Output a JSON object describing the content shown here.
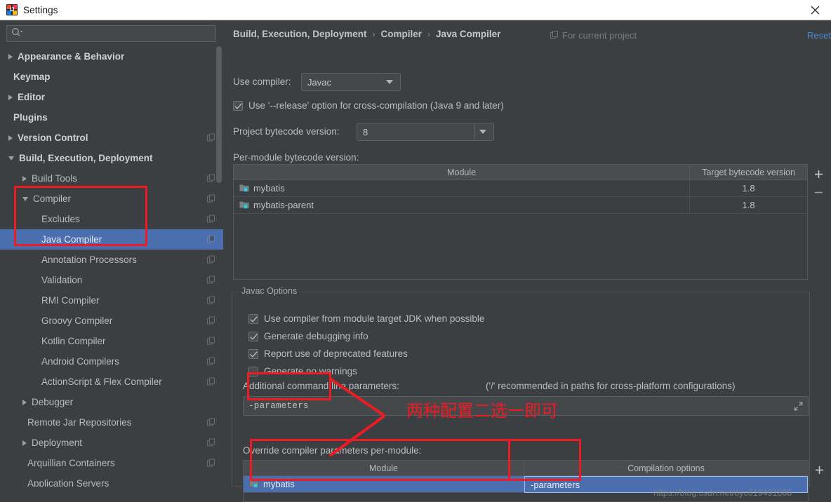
{
  "window": {
    "title": "Settings",
    "app_icon": "intellij-idea-icon",
    "close_icon": "close-icon"
  },
  "sidebar": {
    "search": {
      "placeholder": "",
      "value": "",
      "icon": "search-icon"
    },
    "items": [
      {
        "label": "Appearance & Behavior",
        "indent": 0,
        "arrow": "closed",
        "bold": true,
        "copy": false,
        "selected": false
      },
      {
        "label": "Keymap",
        "indent": 0,
        "arrow": "none",
        "bold": true,
        "copy": false,
        "selected": false
      },
      {
        "label": "Editor",
        "indent": 0,
        "arrow": "closed",
        "bold": true,
        "copy": false,
        "selected": false
      },
      {
        "label": "Plugins",
        "indent": 0,
        "arrow": "none",
        "bold": true,
        "copy": false,
        "selected": false
      },
      {
        "label": "Version Control",
        "indent": 0,
        "arrow": "closed",
        "bold": true,
        "copy": true,
        "selected": false
      },
      {
        "label": "Build, Execution, Deployment",
        "indent": 0,
        "arrow": "open",
        "bold": true,
        "copy": false,
        "selected": false
      },
      {
        "label": "Build Tools",
        "indent": 1,
        "arrow": "closed",
        "bold": false,
        "copy": true,
        "selected": false
      },
      {
        "label": "Compiler",
        "indent": 1,
        "arrow": "open",
        "bold": false,
        "copy": true,
        "selected": false
      },
      {
        "label": "Excludes",
        "indent": 2,
        "arrow": "none",
        "bold": false,
        "copy": true,
        "selected": false
      },
      {
        "label": "Java Compiler",
        "indent": 2,
        "arrow": "none",
        "bold": false,
        "copy": true,
        "selected": true
      },
      {
        "label": "Annotation Processors",
        "indent": 2,
        "arrow": "none",
        "bold": false,
        "copy": true,
        "selected": false
      },
      {
        "label": "Validation",
        "indent": 2,
        "arrow": "none",
        "bold": false,
        "copy": true,
        "selected": false
      },
      {
        "label": "RMI Compiler",
        "indent": 2,
        "arrow": "none",
        "bold": false,
        "copy": true,
        "selected": false
      },
      {
        "label": "Groovy Compiler",
        "indent": 2,
        "arrow": "none",
        "bold": false,
        "copy": true,
        "selected": false
      },
      {
        "label": "Kotlin Compiler",
        "indent": 2,
        "arrow": "none",
        "bold": false,
        "copy": true,
        "selected": false
      },
      {
        "label": "Android Compilers",
        "indent": 2,
        "arrow": "none",
        "bold": false,
        "copy": true,
        "selected": false
      },
      {
        "label": "ActionScript & Flex Compiler",
        "indent": 2,
        "arrow": "none",
        "bold": false,
        "copy": true,
        "selected": false
      },
      {
        "label": "Debugger",
        "indent": 1,
        "arrow": "closed",
        "bold": false,
        "copy": false,
        "selected": false
      },
      {
        "label": "Remote Jar Repositories",
        "indent": 1,
        "arrow": "none",
        "bold": false,
        "copy": true,
        "selected": false
      },
      {
        "label": "Deployment",
        "indent": 1,
        "arrow": "closed",
        "bold": false,
        "copy": true,
        "selected": false
      },
      {
        "label": "Arquillian Containers",
        "indent": 1,
        "arrow": "none",
        "bold": false,
        "copy": true,
        "selected": false
      },
      {
        "label": "Application Servers",
        "indent": 1,
        "arrow": "none",
        "bold": false,
        "copy": false,
        "selected": false
      }
    ]
  },
  "header": {
    "breadcrumb": [
      "Build, Execution, Deployment",
      "Compiler",
      "Java Compiler"
    ],
    "separator": "›",
    "scope_label": "For current project",
    "scope_icon": "copy-icon",
    "reset_label": "Reset",
    "reset_color": "#4e86d6"
  },
  "main": {
    "use_compiler_label": "Use compiler:",
    "use_compiler_value": "Javac",
    "release_option_label": "Use '--release' option for cross-compilation (Java 9 and later)",
    "release_option_checked": true,
    "project_bytecode_label": "Project bytecode version:",
    "project_bytecode_value": "8",
    "per_module_label": "Per-module bytecode version:",
    "bytecode_table": {
      "columns": [
        "Module",
        "Target bytecode version"
      ],
      "rows": [
        {
          "module": "mybatis",
          "version": "1.8"
        },
        {
          "module": "mybatis-parent",
          "version": "1.8"
        }
      ],
      "add_label": "+",
      "remove_label": "–"
    },
    "javac_group_title": "Javac Options",
    "javac_options": [
      {
        "label": "Use compiler from module target JDK when possible",
        "checked": true
      },
      {
        "label": "Generate debugging info",
        "checked": true
      },
      {
        "label": "Report use of deprecated features",
        "checked": true
      },
      {
        "label": "Generate no warnings",
        "checked": false
      }
    ],
    "additional_params_label": "Additional command line parameters:",
    "additional_params_hint": "('/' recommended in paths for cross-platform configurations)",
    "additional_params_value": "-parameters",
    "expand_icon": "expand-icon",
    "override_label": "Override compiler parameters per-module:",
    "override_table": {
      "columns": [
        "Module",
        "Compilation options"
      ],
      "rows": [
        {
          "module": "mybatis",
          "options": "-parameters",
          "selected": true
        }
      ],
      "add_label": "+"
    }
  },
  "annotations": {
    "chinese_note": "两种配置二选一即可",
    "color": "#ee1b24",
    "watermark": "https://blog.csdn.net/oyc619491800"
  }
}
